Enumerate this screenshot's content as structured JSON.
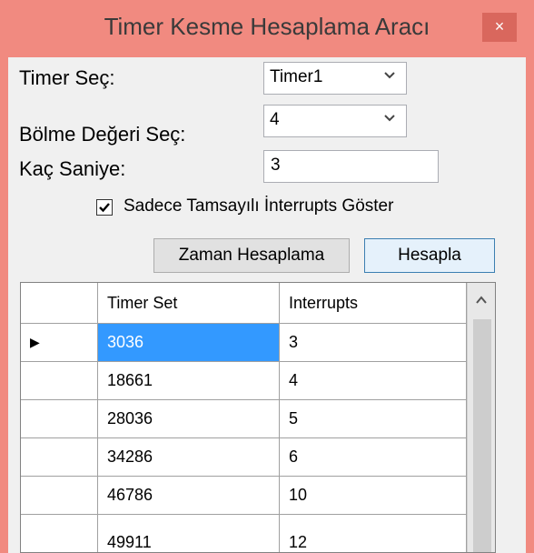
{
  "window": {
    "title": "Timer Kesme Hesaplama Aracı",
    "close_label": "×"
  },
  "form": {
    "timer_label": "Timer Seç:",
    "timer_value": "Timer1",
    "divider_label": "Bölme Değeri  Seç:",
    "divider_value": "4",
    "seconds_label": "Kaç Saniye:",
    "seconds_value": "3",
    "integer_only_label": "Sadece Tamsayılı İnterrupts Göster",
    "integer_only_checked": true,
    "time_calc_button": "Zaman Hesaplama",
    "calculate_button": "Hesapla"
  },
  "grid": {
    "columns": [
      "Timer Set",
      "Interrupts"
    ],
    "rows": [
      {
        "timer_set": "3036",
        "interrupts": "3"
      },
      {
        "timer_set": "18661",
        "interrupts": "4"
      },
      {
        "timer_set": "28036",
        "interrupts": "5"
      },
      {
        "timer_set": "34286",
        "interrupts": "6"
      },
      {
        "timer_set": "46786",
        "interrupts": "10"
      },
      {
        "timer_set": "49911",
        "interrupts": "12"
      }
    ],
    "current_row_marker": "▶"
  },
  "colors": {
    "titlebar": "#f18a80",
    "close_button": "#d9675d",
    "selection": "#3399ff"
  }
}
